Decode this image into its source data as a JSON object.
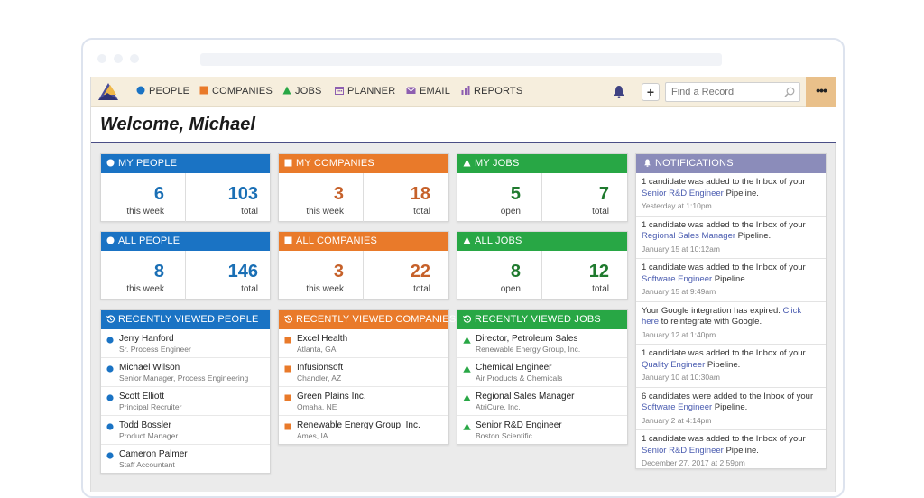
{
  "nav": {
    "items": [
      {
        "label": "PEOPLE",
        "icon": "circle-icon",
        "color": "#1a73c4"
      },
      {
        "label": "COMPANIES",
        "icon": "square-icon",
        "color": "#e97a2a"
      },
      {
        "label": "JOBS",
        "icon": "triangle-icon",
        "color": "#28a745"
      },
      {
        "label": "PLANNER",
        "icon": "calendar-icon",
        "color": "#8e5fb0"
      },
      {
        "label": "EMAIL",
        "icon": "envelope-icon",
        "color": "#8e5fb0"
      },
      {
        "label": "REPORTS",
        "icon": "bar-chart-icon",
        "color": "#8e5fb0"
      }
    ],
    "plus": "+",
    "search_placeholder": "Find a Record",
    "more": "•••"
  },
  "welcome": "Welcome, Michael",
  "cards": {
    "my_people": {
      "title": "MY PEOPLE",
      "v1": "6",
      "l1": "this week",
      "v2": "103",
      "l2": "total"
    },
    "my_companies": {
      "title": "MY COMPANIES",
      "v1": "3",
      "l1": "this week",
      "v2": "18",
      "l2": "total"
    },
    "my_jobs": {
      "title": "MY JOBS",
      "v1": "5",
      "l1": "open",
      "v2": "7",
      "l2": "total"
    },
    "all_people": {
      "title": "ALL PEOPLE",
      "v1": "8",
      "l1": "this week",
      "v2": "146",
      "l2": "total"
    },
    "all_companies": {
      "title": "ALL COMPANIES",
      "v1": "3",
      "l1": "this week",
      "v2": "22",
      "l2": "total"
    },
    "all_jobs": {
      "title": "ALL JOBS",
      "v1": "8",
      "l1": "open",
      "v2": "12",
      "l2": "total"
    }
  },
  "recent_people": {
    "title": "RECENTLY VIEWED PEOPLE",
    "items": [
      {
        "name": "Jerry Hanford",
        "sub": "Sr. Process Engineer"
      },
      {
        "name": "Michael Wilson",
        "sub": "Senior Manager, Process Engineering"
      },
      {
        "name": "Scott Elliott",
        "sub": "Principal Recruiter"
      },
      {
        "name": "Todd Bossler",
        "sub": "Product Manager"
      },
      {
        "name": "Cameron Palmer",
        "sub": "Staff Accountant"
      }
    ]
  },
  "recent_companies": {
    "title": "RECENTLY VIEWED COMPANIES",
    "items": [
      {
        "name": "Excel Health",
        "sub": "Atlanta, GA"
      },
      {
        "name": "Infusionsoft",
        "sub": "Chandler, AZ"
      },
      {
        "name": "Green Plains Inc.",
        "sub": "Omaha, NE"
      },
      {
        "name": "Renewable Energy Group, Inc.",
        "sub": "Ames, IA"
      }
    ]
  },
  "recent_jobs": {
    "title": "RECENTLY VIEWED JOBS",
    "items": [
      {
        "name": "Director, Petroleum Sales",
        "sub": "Renewable Energy Group, Inc."
      },
      {
        "name": "Chemical Engineer",
        "sub": "Air Products & Chemicals"
      },
      {
        "name": "Regional Sales Manager",
        "sub": "AtriCure, Inc."
      },
      {
        "name": "Senior R&D Engineer",
        "sub": "Boston Scientific"
      }
    ]
  },
  "notifications": {
    "title": "NOTIFICATIONS",
    "items": [
      {
        "pre": "1 candidate was added to the Inbox of your ",
        "link": "Senior R&D Engineer",
        "post": " Pipeline.",
        "time": "Yesterday at 1:10pm"
      },
      {
        "pre": "1 candidate was added to the Inbox of your ",
        "link": "Regional Sales Manager",
        "post": " Pipeline.",
        "time": "January 15 at 10:12am"
      },
      {
        "pre": "1 candidate was added to the Inbox of your ",
        "link": "Software Engineer",
        "post": " Pipeline.",
        "time": "January 15 at 9:49am"
      },
      {
        "pre": "Your Google integration has expired. ",
        "link": "Click here",
        "post": " to reintegrate with Google.",
        "time": "January 12 at 1:40pm"
      },
      {
        "pre": "1 candidate was added to the Inbox of your ",
        "link": "Quality Engineer",
        "post": " Pipeline.",
        "time": "January 10 at 10:30am"
      },
      {
        "pre": "6 candidates were added to the Inbox of your ",
        "link": "Software Engineer",
        "post": " Pipeline.",
        "time": "January 2 at 4:14pm"
      },
      {
        "pre": "1 candidate was added to the Inbox of your ",
        "link": "Senior R&D Engineer",
        "post": " Pipeline.",
        "time": "December 27, 2017 at 2:59pm"
      }
    ]
  }
}
